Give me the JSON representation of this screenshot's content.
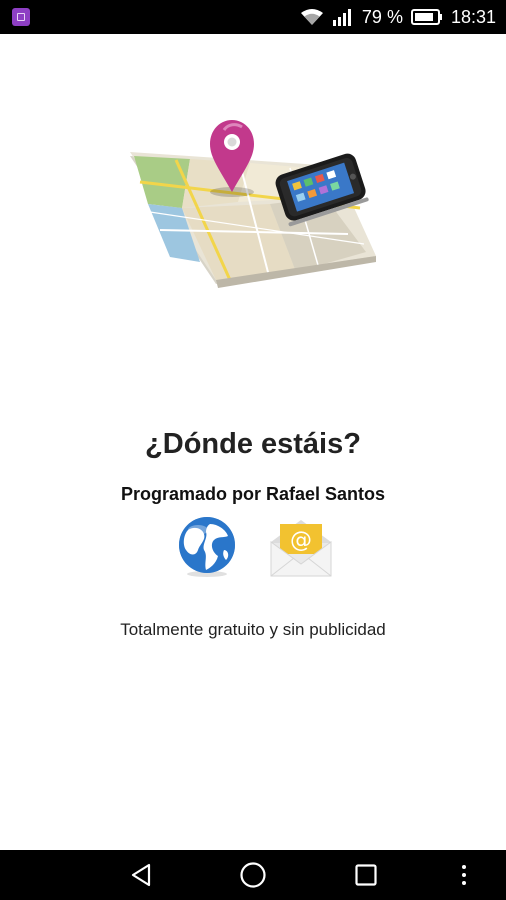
{
  "status_bar": {
    "notification_icon": "app-notification-icon",
    "wifi_icon": "wifi-icon",
    "signal_icon": "signal-icon",
    "battery_percent": "79 %",
    "battery_icon": "battery-icon",
    "time": "18:31"
  },
  "main": {
    "hero_image": "map-pin-phone-illustration",
    "title": "¿Dónde estáis?",
    "author": "Programado por Rafael Santos",
    "web_icon": "globe-icon",
    "email_icon": "email-envelope-icon",
    "tagline": "Totalmente gratuito y sin publicidad"
  },
  "nav_bar": {
    "back_icon": "back-triangle-icon",
    "home_icon": "home-circle-icon",
    "recents_icon": "recents-square-icon",
    "menu_icon": "overflow-menu-icon"
  },
  "colors": {
    "pin": "#c2398c",
    "status_bar_bg": "#000000",
    "nav_bar_bg": "#000000",
    "envelope": "#f2c230"
  }
}
